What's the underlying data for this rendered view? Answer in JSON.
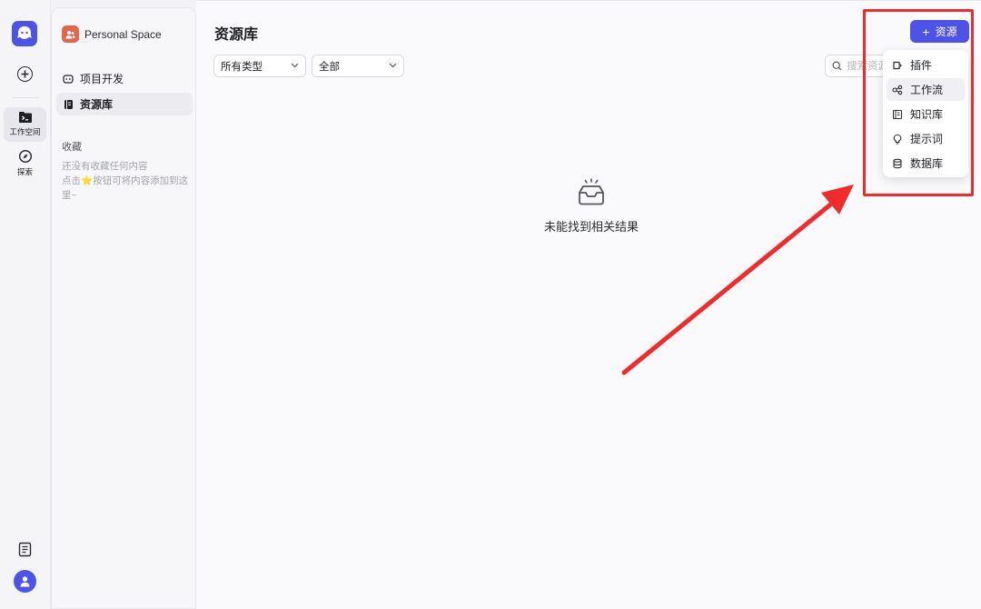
{
  "rail": {
    "workspace_label": "工作空间",
    "explore_label": "探索"
  },
  "sidebar": {
    "space_name": "Personal Space",
    "items": [
      {
        "label": "项目开发"
      },
      {
        "label": "资源库"
      }
    ],
    "favorites_title": "收藏",
    "favorites_empty_line1": "还没有收藏任何内容",
    "favorites_empty_line2_a": "点击",
    "favorites_empty_line2_b": "按钮可将内容添加到这里~"
  },
  "main": {
    "title": "资源库",
    "filter_type": "所有类型",
    "filter_scope": "全部",
    "search_placeholder": "搜索资源",
    "empty_text": "未能找到相关结果",
    "add_button_label": "资源",
    "dropdown": [
      {
        "label": "插件",
        "icon": "plugin-icon"
      },
      {
        "label": "工作流",
        "icon": "workflow-icon"
      },
      {
        "label": "知识库",
        "icon": "knowledge-icon"
      },
      {
        "label": "提示词",
        "icon": "prompt-icon"
      },
      {
        "label": "数据库",
        "icon": "database-icon"
      }
    ]
  },
  "colors": {
    "accent": "#4d53e8",
    "annotation": "#f12b2b",
    "space_badge": "#e2664c"
  }
}
